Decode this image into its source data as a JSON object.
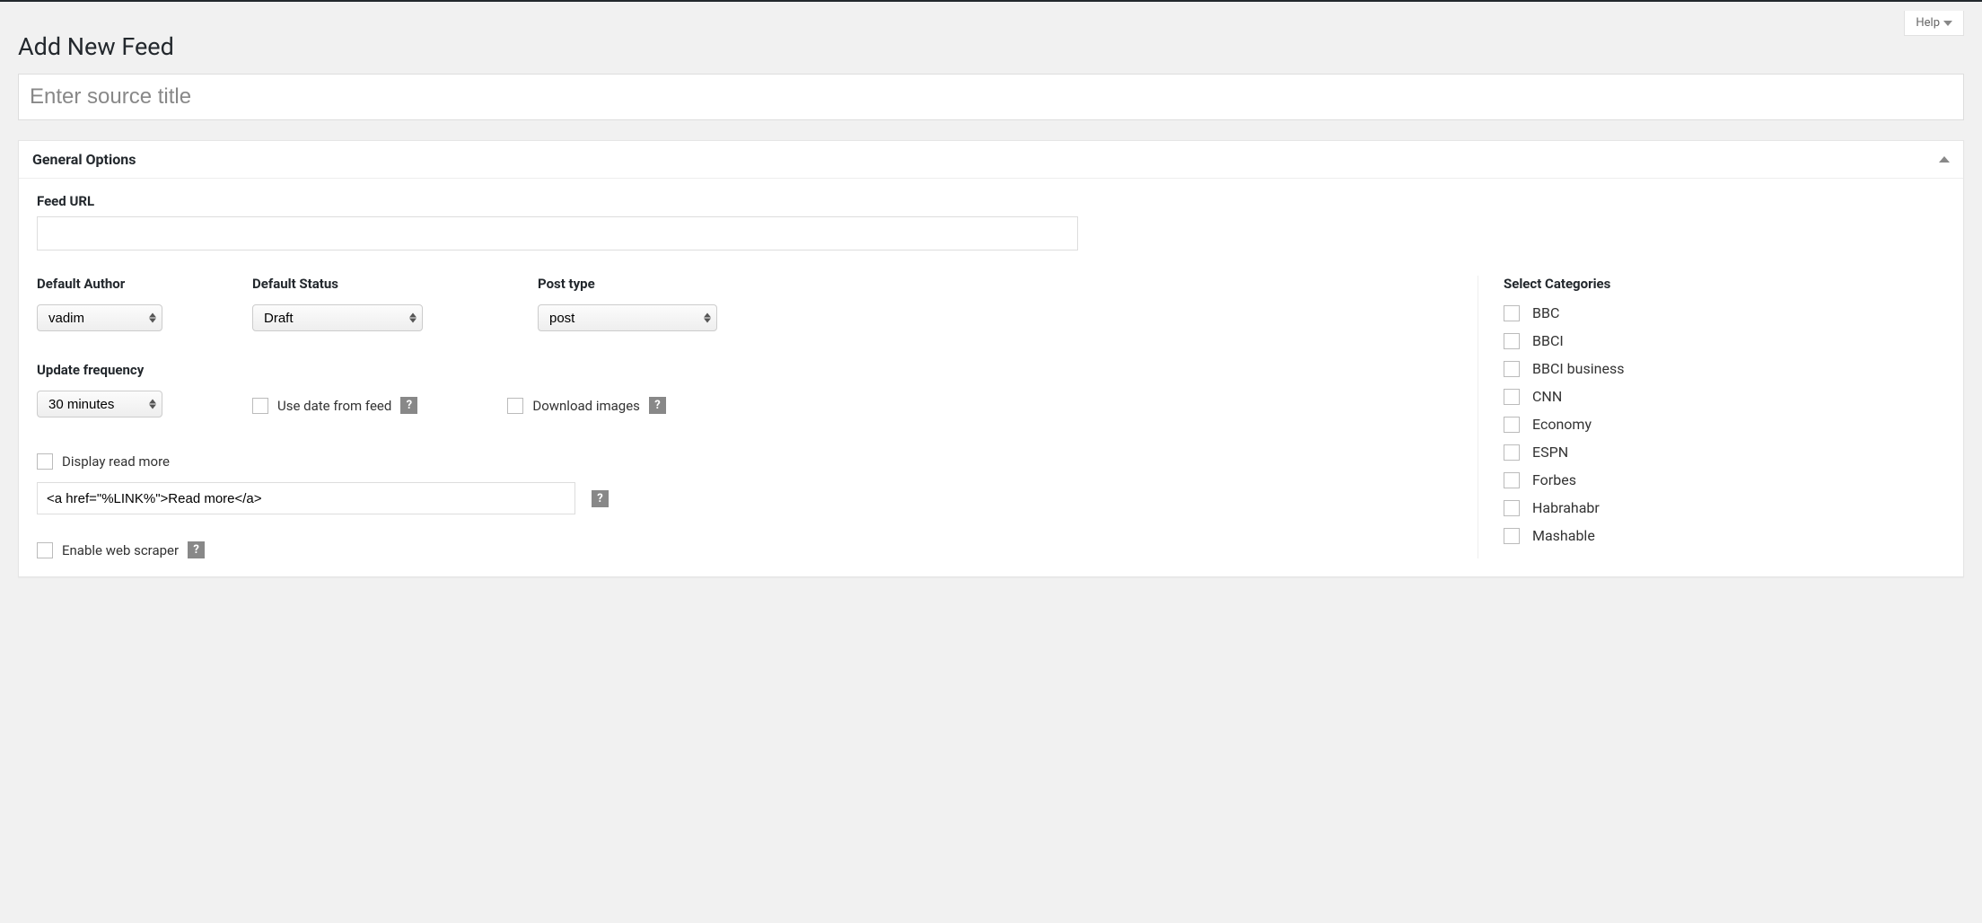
{
  "help": {
    "label": "Help"
  },
  "page": {
    "title": "Add New Feed"
  },
  "titleInput": {
    "placeholder": "Enter source title",
    "value": ""
  },
  "panel": {
    "title": "General Options"
  },
  "feedUrl": {
    "label": "Feed URL",
    "value": ""
  },
  "defaultAuthor": {
    "label": "Default Author",
    "value": "vadim"
  },
  "defaultStatus": {
    "label": "Default Status",
    "value": "Draft"
  },
  "postType": {
    "label": "Post type",
    "value": "post"
  },
  "updateFrequency": {
    "label": "Update frequency",
    "value": "30 minutes"
  },
  "useDateFromFeed": {
    "label": "Use date from feed"
  },
  "downloadImages": {
    "label": "Download images"
  },
  "displayReadMore": {
    "label": "Display read more"
  },
  "readMoreTemplate": {
    "value": "<a href=\"%LINK%\">Read more</a>"
  },
  "enableWebScraper": {
    "label": "Enable web scraper"
  },
  "categories": {
    "label": "Select Categories",
    "items": [
      "BBC",
      "BBCI",
      "BBCI business",
      "CNN",
      "Economy",
      "ESPN",
      "Forbes",
      "Habrahabr",
      "Mashable"
    ]
  },
  "helpIcon": "?"
}
